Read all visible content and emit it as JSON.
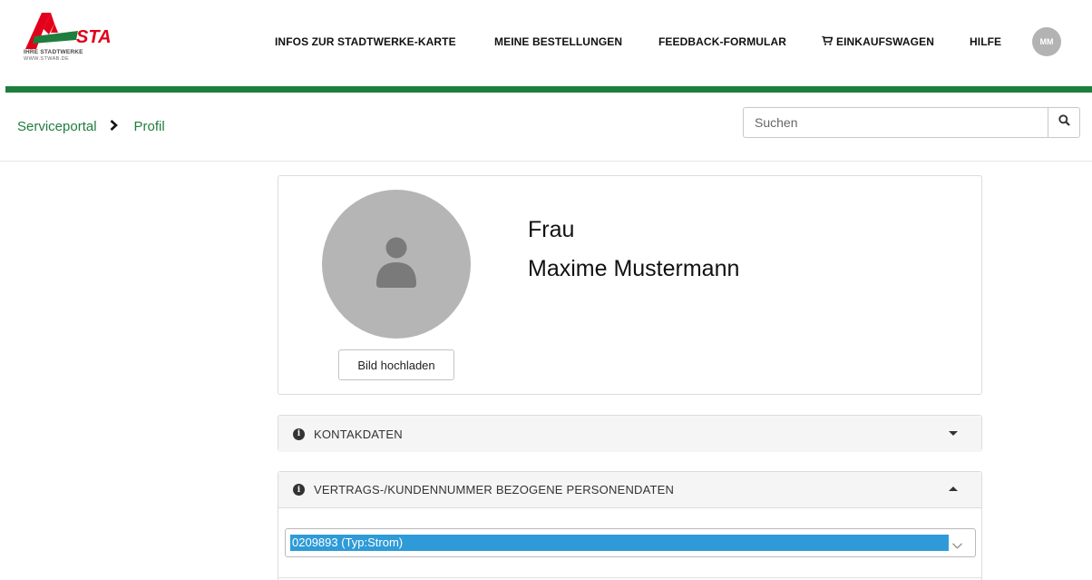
{
  "brand": {
    "logo_text": "STA",
    "tagline": "IHRE STADTWERKE",
    "url": "WWW.STWAB.DE",
    "accent_color": "#1f7e3d",
    "logo_red": "#e2001a"
  },
  "nav": {
    "items": [
      {
        "label": "INFOS ZUR STADTWERKE-KARTE"
      },
      {
        "label": "MEINE BESTELLUNGEN"
      },
      {
        "label": "FEEDBACK-FORMULAR"
      },
      {
        "label": "EINKAUFSWAGEN",
        "icon": "cart-icon"
      },
      {
        "label": "HILFE"
      }
    ],
    "user_initials": "MM"
  },
  "breadcrumb": {
    "items": [
      "Serviceportal",
      "Profil"
    ],
    "separator_icon": "chevron-right-icon"
  },
  "search": {
    "placeholder": "Suchen",
    "icon": "search-icon"
  },
  "profile": {
    "salutation": "Frau",
    "name": "Maxime Mustermann",
    "upload_label": "Bild hochladen",
    "avatar_icon": "user-icon"
  },
  "panels": [
    {
      "title": "KONTAKDATEN",
      "expanded": false
    },
    {
      "title": "VERTRAGS-/KUNDENNUMMER BEZOGENE PERSONENDATEN",
      "expanded": true
    }
  ],
  "contract_select": {
    "value": "0209893 (Typ:Strom)"
  }
}
